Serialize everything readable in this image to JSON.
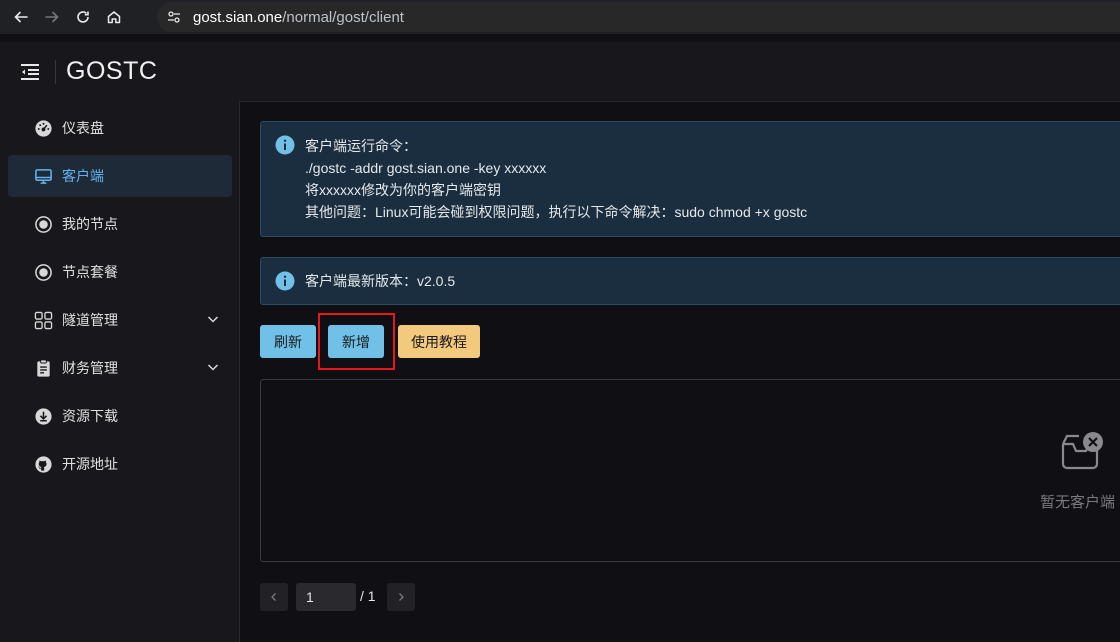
{
  "browser": {
    "url_host": "gost.sian.one",
    "url_path": "/normal/gost/client"
  },
  "header": {
    "title": "GOSTC"
  },
  "sidebar": {
    "items": [
      {
        "label": "仪表盘",
        "icon": "dashboard-gauge-icon"
      },
      {
        "label": "客户端",
        "icon": "monitor-icon",
        "active": true
      },
      {
        "label": "我的节点",
        "icon": "radio-circle-icon"
      },
      {
        "label": "节点套餐",
        "icon": "radio-circle-icon"
      },
      {
        "label": "隧道管理",
        "icon": "grid-apps-icon",
        "expandable": true
      },
      {
        "label": "财务管理",
        "icon": "clipboard-icon",
        "expandable": true
      },
      {
        "label": "资源下载",
        "icon": "download-circle-icon"
      },
      {
        "label": "开源地址",
        "icon": "github-icon"
      }
    ]
  },
  "alerts": {
    "command": {
      "lines": [
        "客户端运行命令：",
        "./gostc -addr gost.sian.one -key xxxxxx",
        "将xxxxxx修改为你的客户端密钥",
        "其他问题：Linux可能会碰到权限问题，执行以下命令解决：sudo chmod +x gostc"
      ]
    },
    "version": {
      "text": "客户端最新版本：v2.0.5"
    }
  },
  "toolbar": {
    "refresh_label": "刷新",
    "add_label": "新增",
    "tutorial_label": "使用教程"
  },
  "table": {
    "empty_text": "暂无客户端"
  },
  "pagination": {
    "current_page": "1",
    "total_text": "/ 1"
  },
  "colors": {
    "accent": "#70c0e8",
    "warning": "#f2c97d",
    "active_text": "#63b3ed",
    "highlight": "#e5181e"
  }
}
